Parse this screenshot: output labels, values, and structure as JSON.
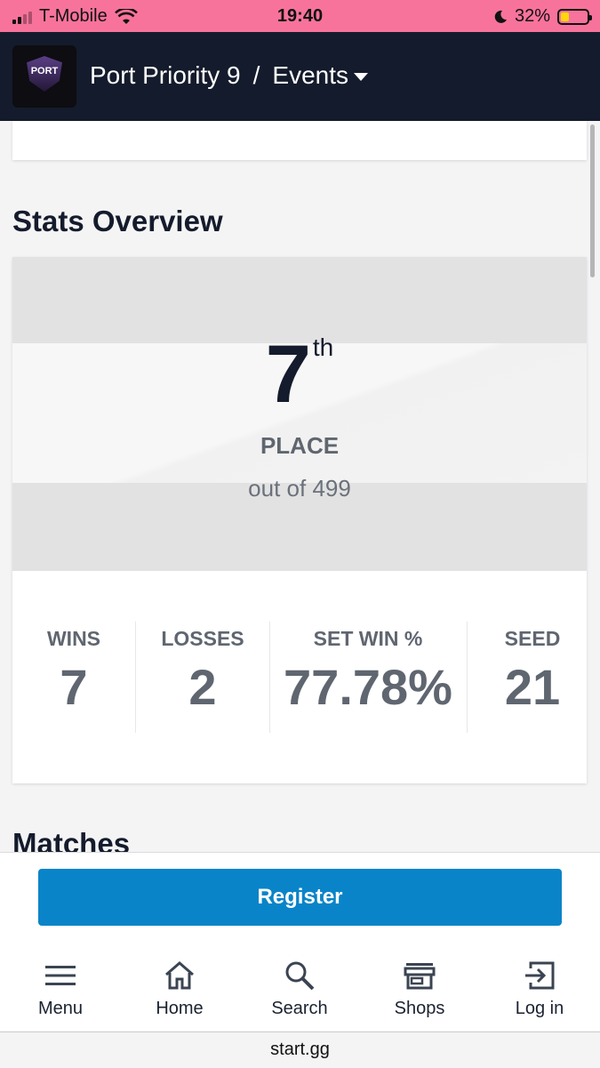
{
  "status_bar": {
    "carrier": "T-Mobile",
    "time": "19:40",
    "battery": "32%"
  },
  "header": {
    "logo_text": "PORT",
    "tournament": "Port Priority 9",
    "separator": "/",
    "section": "Events"
  },
  "stats_overview": {
    "title": "Stats Overview",
    "place": "7",
    "place_suffix": "th",
    "place_label": "PLACE",
    "out_of": "out of 499",
    "stats": [
      {
        "label": "WINS",
        "value": "7"
      },
      {
        "label": "LOSSES",
        "value": "2"
      },
      {
        "label": "SET WIN %",
        "value": "77.78%"
      },
      {
        "label": "SEED",
        "value": "21"
      }
    ]
  },
  "matches_title": "Matches",
  "register_label": "Register",
  "nav": [
    {
      "label": "Menu",
      "icon": "menu-icon"
    },
    {
      "label": "Home",
      "icon": "home-icon"
    },
    {
      "label": "Search",
      "icon": "search-icon"
    },
    {
      "label": "Shops",
      "icon": "shop-icon"
    },
    {
      "label": "Log in",
      "icon": "login-icon"
    }
  ],
  "url": "start.gg"
}
